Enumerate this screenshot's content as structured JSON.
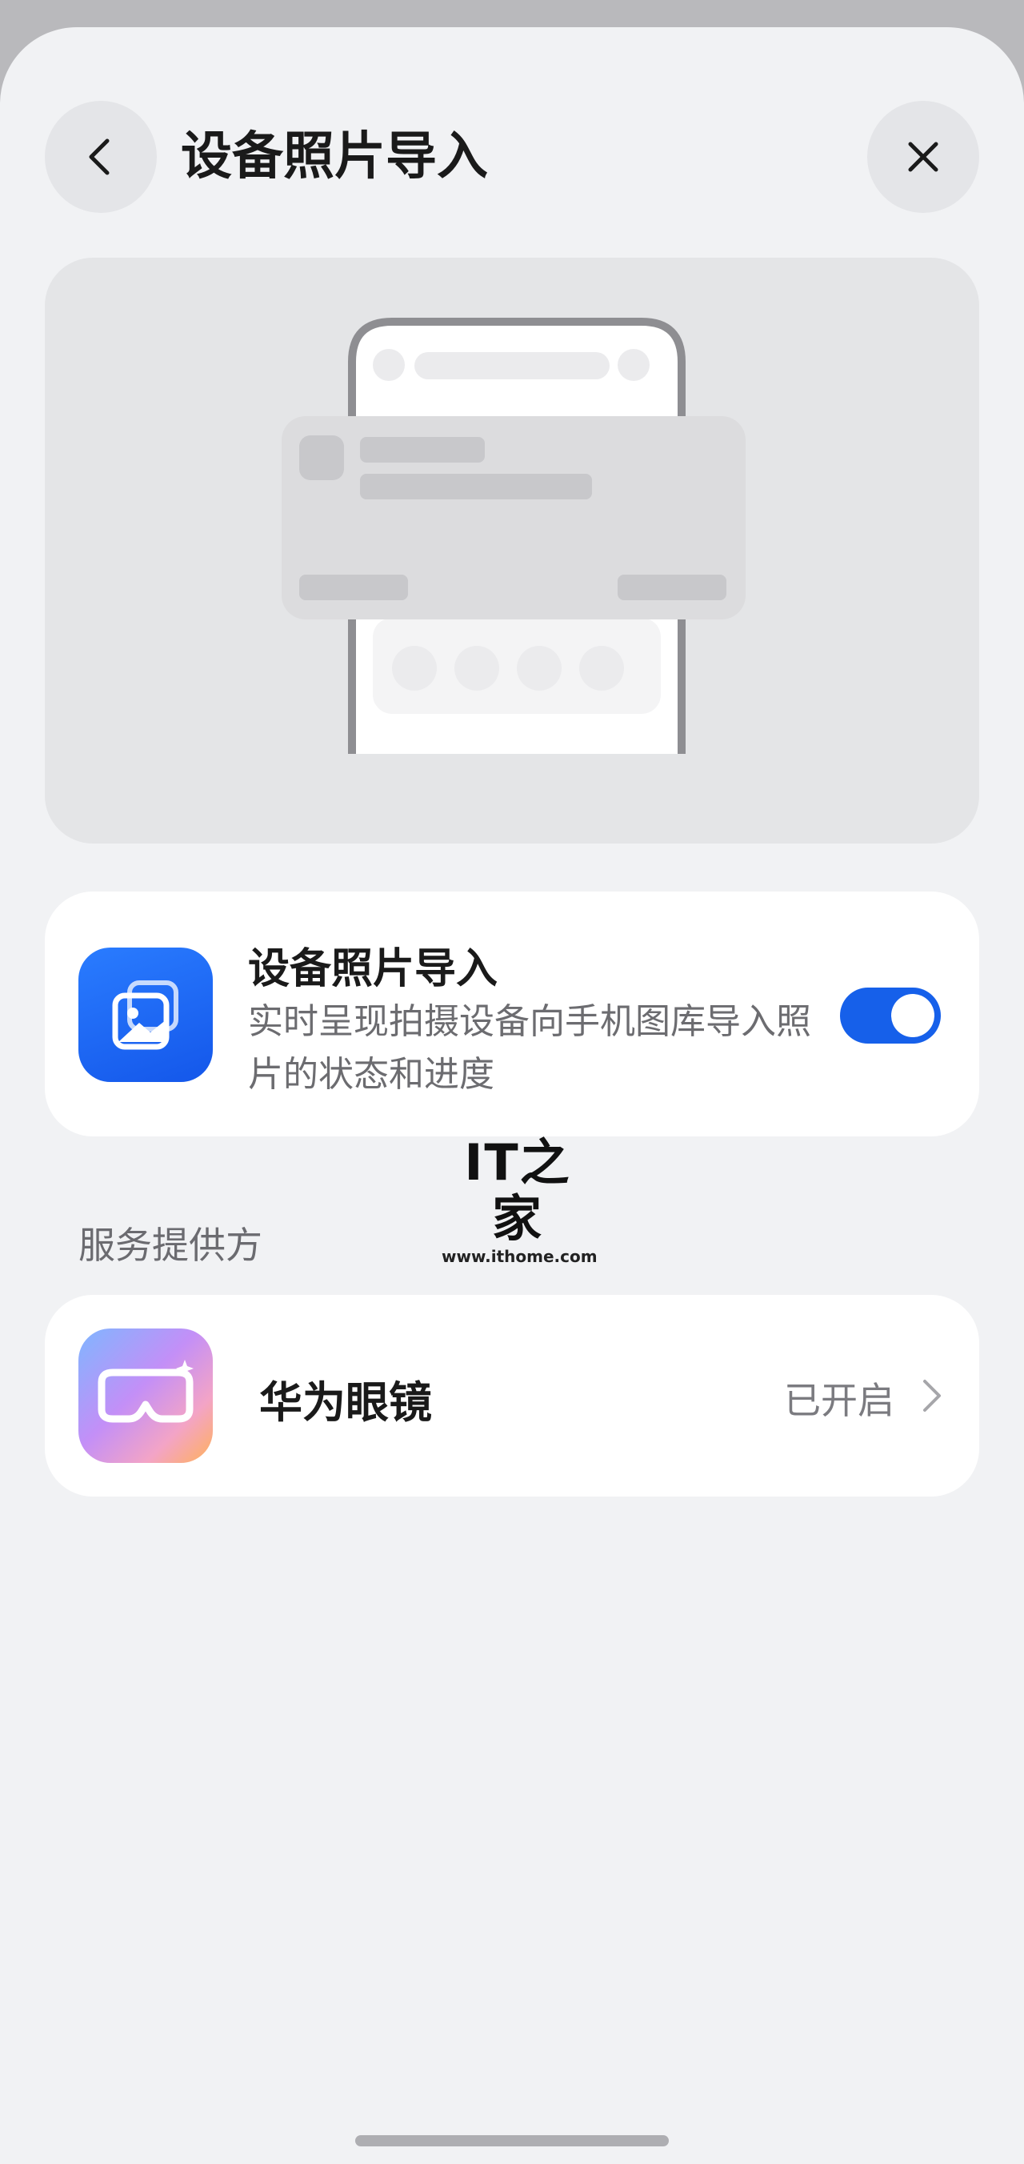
{
  "header": {
    "title": "设备照片导入",
    "back_icon": "chevron-left-icon",
    "close_icon": "close-icon"
  },
  "feature": {
    "title": "设备照片导入",
    "description": "实时呈现拍摄设备向手机图库导入照片的状态和进度",
    "icon": "photo-gallery-icon",
    "toggle_on": true,
    "accent": "#1660ea"
  },
  "providers": {
    "section_label": "服务提供方",
    "items": [
      {
        "name": "华为眼镜",
        "status": "已开启",
        "icon": "glasses-icon"
      }
    ]
  },
  "watermark": {
    "logo": "IT之家",
    "url": "www.ithome.com"
  }
}
